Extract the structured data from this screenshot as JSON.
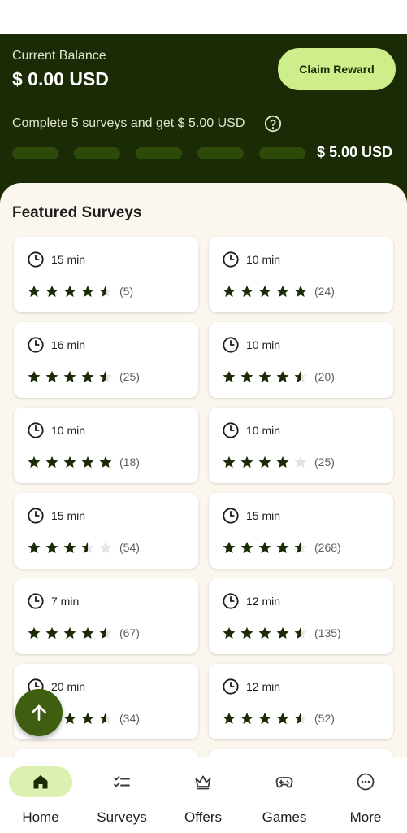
{
  "header": {
    "balance_label": "Current Balance",
    "balance_value": "$ 0.00 USD",
    "claim_label": "Claim Reward",
    "progress_text": "Complete 5 surveys and get $ 5.00 USD",
    "progress_segments": 5,
    "progress_completed": 0,
    "target_amount": "$ 5.00 USD"
  },
  "featured": {
    "title": "Featured Surveys",
    "surveys": [
      {
        "duration": "15 min",
        "rating": 4.5,
        "count": "(5)"
      },
      {
        "duration": "10 min",
        "rating": 5,
        "count": "(24)"
      },
      {
        "duration": "16 min",
        "rating": 4.5,
        "count": "(25)"
      },
      {
        "duration": "10 min",
        "rating": 4.5,
        "count": "(20)"
      },
      {
        "duration": "10 min",
        "rating": 5,
        "count": "(18)"
      },
      {
        "duration": "10 min",
        "rating": 4,
        "count": "(25)"
      },
      {
        "duration": "15 min",
        "rating": 3.5,
        "count": "(54)"
      },
      {
        "duration": "15 min",
        "rating": 4.5,
        "count": "(268)"
      },
      {
        "duration": "7 min",
        "rating": 4.5,
        "count": "(67)"
      },
      {
        "duration": "12 min",
        "rating": 4.5,
        "count": "(135)"
      },
      {
        "duration": "20 min",
        "rating": 4.5,
        "count": "(34)"
      },
      {
        "duration": "12 min",
        "rating": 4.5,
        "count": "(52)"
      }
    ]
  },
  "nav": {
    "items": [
      {
        "label": "Home",
        "icon": "home-icon",
        "active": true
      },
      {
        "label": "Surveys",
        "icon": "checklist-icon",
        "active": false
      },
      {
        "label": "Offers",
        "icon": "crown-icon",
        "active": false
      },
      {
        "label": "Games",
        "icon": "gamepad-icon",
        "active": false
      },
      {
        "label": "More",
        "icon": "more-icon",
        "active": false
      }
    ]
  },
  "colors": {
    "header_bg": "#1b2b05",
    "accent": "#cdee8a",
    "star_filled": "#1b2b05",
    "star_empty": "#e4e4e4",
    "fab_bg": "#3f5e10"
  }
}
